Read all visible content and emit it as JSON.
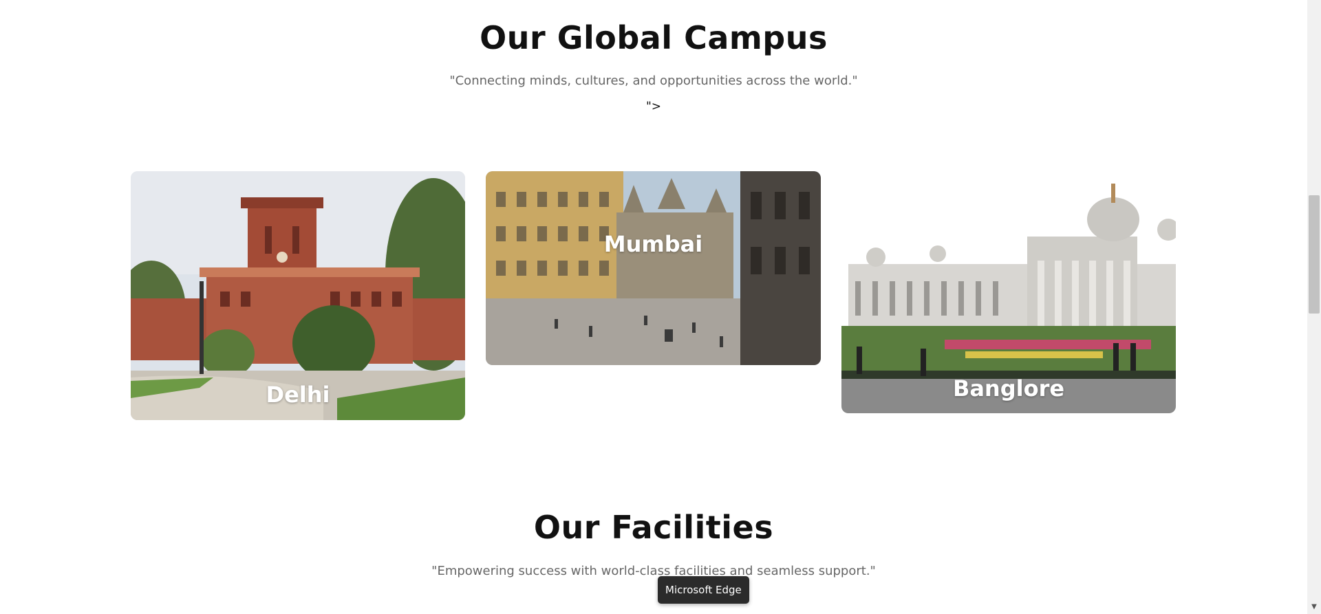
{
  "campus_section": {
    "title": "Our Global Campus",
    "subtitle": "\"Connecting minds, cultures, and opportunities across the world.\"",
    "stray_text": "\">"
  },
  "campus_cards": [
    {
      "label": "Delhi"
    },
    {
      "label": "Mumbai"
    },
    {
      "label": "Banglore"
    }
  ],
  "facilities_section": {
    "title": "Our Facilities",
    "subtitle": "\"Empowering success with world-class facilities and seamless support.\""
  },
  "tooltip": {
    "text": "Microsoft Edge"
  },
  "icons": {
    "scroll_down": "chevron-down-icon"
  }
}
